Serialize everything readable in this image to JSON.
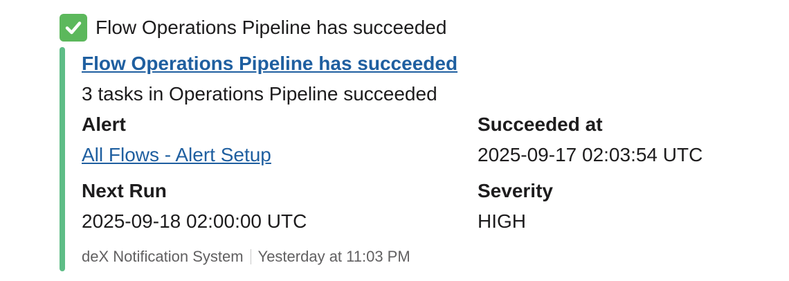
{
  "header": {
    "icon": "check-mark-icon",
    "text": "Flow Operations Pipeline has succeeded"
  },
  "attachment": {
    "accent_color": "#5ebd86",
    "title": "Flow Operations Pipeline has succeeded",
    "description": "3 tasks in Operations Pipeline succeeded",
    "fields": {
      "alert": {
        "label": "Alert",
        "value": "All Flows - Alert Setup"
      },
      "succeeded_at": {
        "label": "Succeeded at",
        "value": "2025-09-17 02:03:54 UTC"
      },
      "next_run": {
        "label": "Next Run",
        "value": "2025-09-18 02:00:00 UTC"
      },
      "severity": {
        "label": "Severity",
        "value": "HIGH"
      }
    },
    "footer": {
      "source": "deX Notification System",
      "timestamp": "Yesterday at 11:03 PM"
    }
  }
}
